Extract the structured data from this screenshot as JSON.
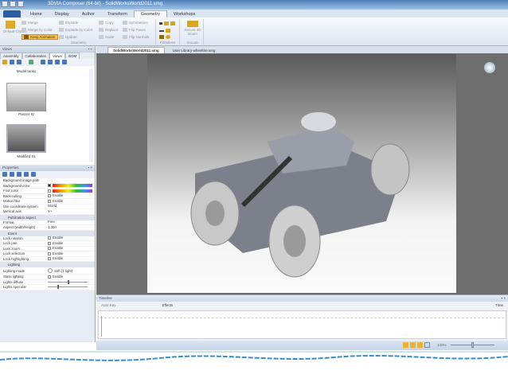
{
  "window": {
    "title": "3DVIA Composer (64-bit) - SolidWorksWorld2011.smg"
  },
  "ribbon": {
    "tabs": [
      "Home",
      "Display",
      "Author",
      "Transform",
      "Geometry",
      "Workshops"
    ],
    "active_tab": "Geometry",
    "default_clones": "Default Clones",
    "merge": "Merge",
    "merge_by_color": "Merge by Color",
    "keep_animation": "Keep Animation",
    "explode": "Explode",
    "explode_by_color": "Explode by Color",
    "update": "Update",
    "copy": "Copy",
    "replace": "Replace",
    "scale": "Scale",
    "symmetries": "Symmetries",
    "flip_faces": "Flip Faces",
    "flip_normals": "Flip Normals",
    "secure_3d_boom": "Secure 3D Boom",
    "group_geometry": "Geometry",
    "group_primitives": "Primitives",
    "group_secure": "Secure"
  },
  "views_panel": {
    "title": "Views",
    "tabs": [
      "Assembly",
      "Collaboration",
      "Views",
      "BOM"
    ],
    "active_tab": "Views",
    "items": [
      {
        "label": "Model tanks"
      },
      {
        "label": "Panzer IV"
      },
      {
        "label": "Modified 01"
      }
    ]
  },
  "properties": {
    "title": "Properties",
    "rows": [
      {
        "key": "Background image path",
        "value": ""
      },
      {
        "key": "Background color",
        "value": ""
      },
      {
        "key": "Foot color",
        "value": ""
      },
      {
        "key": "Back culling",
        "value": "Enable"
      },
      {
        "key": "Motion blur",
        "value": "Enable"
      },
      {
        "key": "Use coordinate system",
        "value": "World"
      },
      {
        "key": "Vertical axis",
        "value": "Y+"
      }
    ],
    "publication_aspect": {
      "title": "Publication aspect",
      "format_key": "Format",
      "format_value": "Free",
      "aspect_key": "Aspect (width/height)",
      "aspect_value": "1.300"
    },
    "event": {
      "title": "Event",
      "rows": [
        {
          "key": "Lock rotation",
          "value": "Enable"
        },
        {
          "key": "Lock pan",
          "value": "Enable"
        },
        {
          "key": "Lock zoom",
          "value": "Enable"
        },
        {
          "key": "Lock selection",
          "value": "Enable"
        },
        {
          "key": "Lock highlighting",
          "value": "Enable"
        }
      ]
    },
    "lighting": {
      "title": "Lighting",
      "mode_key": "Lighting mode",
      "mode_value": "Soft (1 light)",
      "static_key": "Static lighting",
      "static_value": "Enable",
      "diffuse_key": "Lights diffuse",
      "specular_key": "Lights specular",
      "diffuse_level": 0.5,
      "specular_level": 0.25
    }
  },
  "documents": {
    "tabs": [
      "SolidWorksWorld2011.smg",
      "User Library-wheeltire.smg"
    ],
    "active": "SolidWorksWorld2011.smg"
  },
  "timeline": {
    "title": "Timeline",
    "auto_key": "Auto-Key",
    "effects": "Effects",
    "time": "Time"
  },
  "status": {
    "zoom": "100%"
  }
}
